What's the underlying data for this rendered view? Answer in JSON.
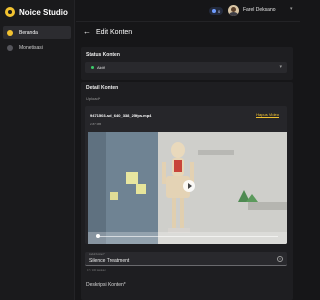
{
  "app": {
    "name": "Noice Studio"
  },
  "sidebar": {
    "items": [
      {
        "label": "Beranda",
        "icon": "home-icon",
        "active": true
      },
      {
        "label": "Monetisasi",
        "icon": "monetization-icon",
        "active": false
      }
    ]
  },
  "topbar": {
    "coins": "0",
    "username": "Farel Deksano"
  },
  "page": {
    "title": "Edit Konten"
  },
  "status_section": {
    "title": "Status Konten",
    "value": "Aktif",
    "status_color": "#3ccb6a"
  },
  "detail_section": {
    "title": "Detail Konten",
    "upload_label": "Upload*",
    "file": {
      "name": "9471503-sd_640_338_25fps.mp4",
      "size": "2.87 MB",
      "delete_label": "Hapus Video"
    },
    "title_field": {
      "label": "Judul Konten*",
      "value": "Silence Treatment",
      "counter": "17 / 100 karakter"
    },
    "description_label": "Deskripsi Konten*"
  },
  "colors": {
    "accent": "#f2c230",
    "background": "#161618",
    "card": "#1e1e21"
  }
}
